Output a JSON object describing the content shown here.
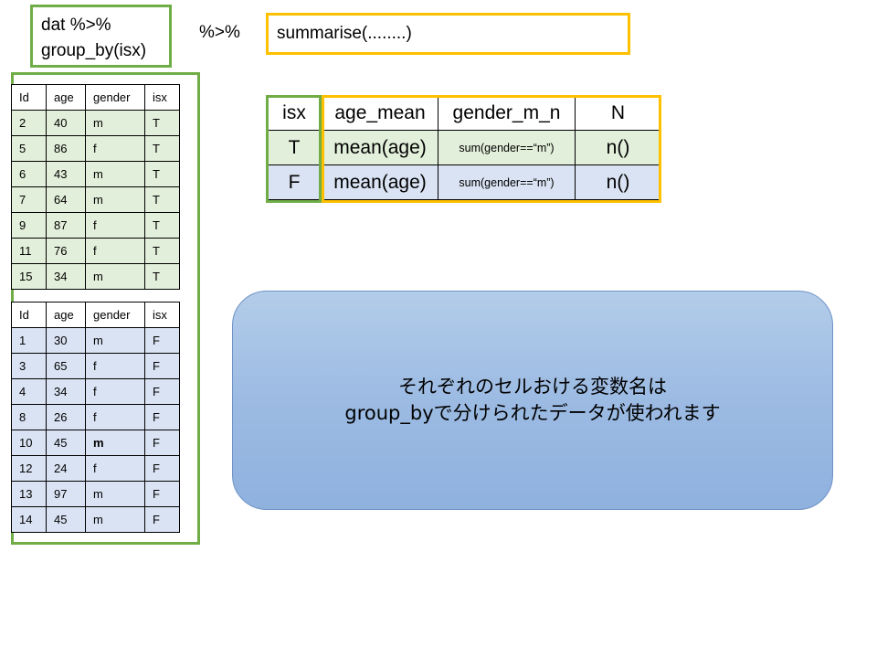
{
  "code_block": {
    "line1": "dat %>%",
    "line2": "group_by(isx)"
  },
  "pipe_operator": "%>%",
  "summarise_code": "summarise(........)",
  "group_tables": [
    {
      "headers": [
        "Id",
        "age",
        "gender",
        "isx"
      ],
      "rows": [
        [
          "2",
          "40",
          "m",
          "T"
        ],
        [
          "5",
          "86",
          "f",
          "T"
        ],
        [
          "6",
          "43",
          "m",
          "T"
        ],
        [
          "7",
          "64",
          "m",
          "T"
        ],
        [
          "9",
          "87",
          "f",
          "T"
        ],
        [
          "11",
          "76",
          "f",
          "T"
        ],
        [
          "15",
          "34",
          "m",
          "T"
        ]
      ]
    },
    {
      "headers": [
        "Id",
        "age",
        "gender",
        "isx"
      ],
      "rows": [
        [
          "1",
          "30",
          "m",
          "F"
        ],
        [
          "3",
          "65",
          "f",
          "F"
        ],
        [
          "4",
          "34",
          "f",
          "F"
        ],
        [
          "8",
          "26",
          "f",
          "F"
        ],
        [
          "10",
          "45",
          "m",
          "F"
        ],
        [
          "12",
          "24",
          "f",
          "F"
        ],
        [
          "13",
          "97",
          "m",
          "F"
        ],
        [
          "14",
          "45",
          "m",
          "F"
        ]
      ]
    }
  ],
  "summary_table": {
    "headers": [
      "isx",
      "age_mean",
      "gender_m_n",
      "N"
    ],
    "rows": [
      [
        "T",
        "mean(age)",
        "sum(gender==“m”)",
        "n()"
      ],
      [
        "F",
        "mean(age)",
        "sum(gender==“m”)",
        "n()"
      ]
    ]
  },
  "callout": {
    "line1": "それぞれのセルおける変数名は",
    "line2": "group_byで分けられたデータが使われます"
  },
  "colors": {
    "group_frame": "#70ad47",
    "summarise_frame": "#ffc000",
    "group_T_fill": "#e2efda",
    "group_F_fill": "#dae3f3",
    "callout_fill": "#9cbbe3"
  }
}
